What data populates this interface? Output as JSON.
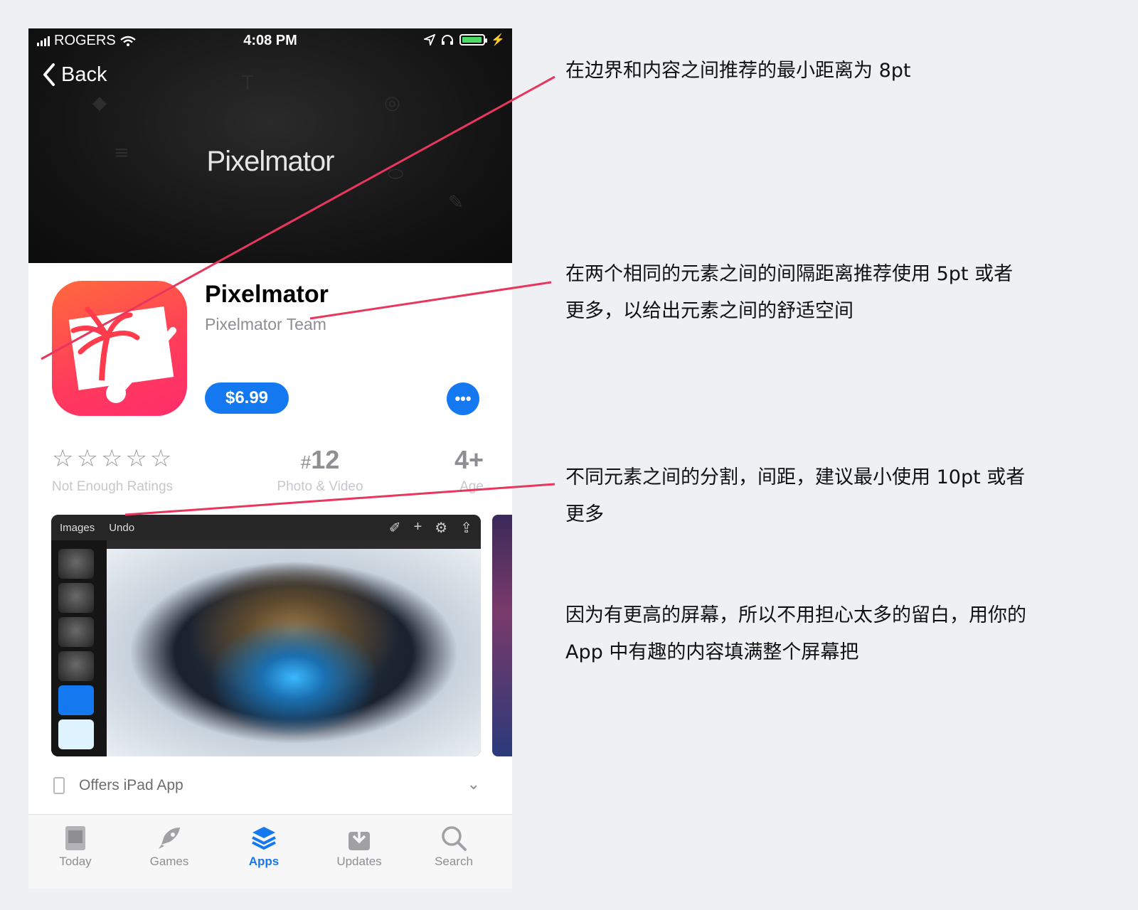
{
  "status_bar": {
    "carrier": "ROGERS",
    "time": "4:08 PM"
  },
  "nav": {
    "back_label": "Back"
  },
  "banner": {
    "title": "Pixelmator"
  },
  "app": {
    "name": "Pixelmator",
    "developer": "Pixelmator Team",
    "price": "$6.99",
    "more_label": "•••"
  },
  "ratings": {
    "stars": "☆☆☆☆☆",
    "stars_label": "Not Enough Ratings",
    "rank_hash": "#",
    "rank_value": "12",
    "rank_label": "Photo & Video",
    "age_value": "4+",
    "age_label": "Age"
  },
  "screenshot": {
    "toolbar_left": [
      "Images",
      "Undo"
    ]
  },
  "offers": {
    "label": "Offers iPad App"
  },
  "tabbar": {
    "tabs": [
      {
        "label": "Today",
        "icon": "today-icon"
      },
      {
        "label": "Games",
        "icon": "rocket-icon"
      },
      {
        "label": "Apps",
        "icon": "layers-icon",
        "active": true
      },
      {
        "label": "Updates",
        "icon": "download-icon"
      },
      {
        "label": "Search",
        "icon": "search-icon"
      }
    ]
  },
  "annotations": {
    "note1": "在边界和内容之间推荐的最小距离为 8pt",
    "note2_line1": "在两个相同的元素之间的间隔距离推荐使用 5pt 或者",
    "note2_line2": "更多，以给出元素之间的舒适空间",
    "note3_line1": "不同元素之间的分割，间距，建议最小使用 10pt 或者",
    "note3_line2": "更多",
    "note4_line1": "因为有更高的屏幕，所以不用担心太多的留白，用你的",
    "note4_line2": "App 中有趣的内容填满整个屏幕把"
  },
  "colors": {
    "accent": "#1479f0",
    "annotation_line": "#e8365d",
    "banner_bg": "#121212"
  }
}
